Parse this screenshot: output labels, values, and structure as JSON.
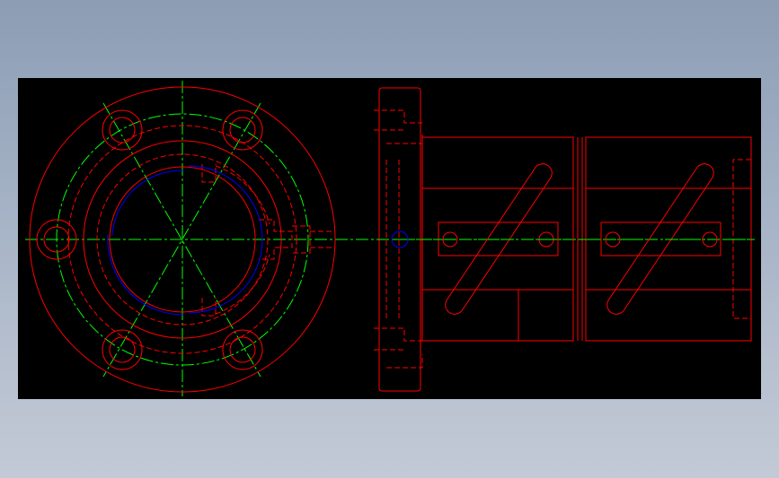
{
  "drawing": {
    "background": "#000000",
    "page_background": "#9aa8bd",
    "colors": {
      "outline": "#ff0000",
      "hidden": "#ff0000",
      "center": "#00ff00",
      "accent": "#0000ff"
    }
  }
}
